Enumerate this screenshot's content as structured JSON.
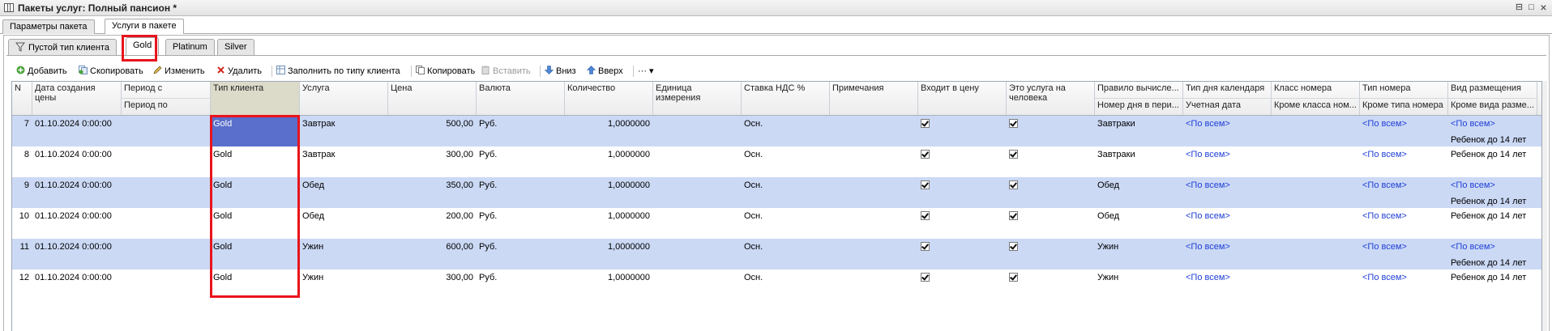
{
  "window": {
    "title": "Пакеты услуг: Полный пансион *",
    "restore_glyph": "⊟",
    "maximize_glyph": "□",
    "close_glyph": "×"
  },
  "main_tabs": [
    {
      "label": "Параметры пакета",
      "active": false
    },
    {
      "label": "Услуги в пакете",
      "active": true
    }
  ],
  "client_tabs": [
    {
      "label": "Пустой тип клиента",
      "active": false
    },
    {
      "label": "Gold",
      "active": true
    },
    {
      "label": "Platinum",
      "active": false
    },
    {
      "label": "Silver",
      "active": false
    }
  ],
  "toolbar": {
    "add": "Добавить",
    "copy_row": "Скопировать",
    "edit": "Изменить",
    "delete": "Удалить",
    "fill_by_client_type": "Заполнить по типу клиента",
    "copy": "Копировать",
    "paste": "Вставить",
    "down": "Вниз",
    "up": "Вверх",
    "more": "··· ▾"
  },
  "columns": {
    "n": "N",
    "date": "Дата создания цены",
    "period_from": "Период с",
    "period_to": "Период по",
    "client_type": "Тип клиента",
    "service": "Услуга",
    "price": "Цена",
    "currency": "Валюта",
    "quantity": "Количество",
    "unit": "Единица измерения",
    "vat": "Ставка НДС %",
    "notes": "Примечания",
    "in_price": "Входит в цену",
    "per_person": "Это услуга на человека",
    "calc_rule": "Правило вычисле...",
    "day_no": "Номер дня в пери...",
    "calendar_day": "Тип дня календаря",
    "account_date": "Учетная дата",
    "room_class": "Класс номера",
    "except_room_class": "Кроме класса ном...",
    "room_type": "Тип номера",
    "except_room_type": "Кроме типа номера",
    "accommodation": "Вид размещения",
    "except_accommodation": "Кроме вида разме..."
  },
  "rows": [
    {
      "n": "7",
      "date": "01.10.2024 0:00:00",
      "client_type": "Gold",
      "service": "Завтрак",
      "price": "500,00",
      "currency": "Руб.",
      "quantity": "1,0000000",
      "vat": "Осн.",
      "in_price": true,
      "per_person": true,
      "calc_rule": "Завтраки",
      "calendar_day": "<По всем>",
      "room_type": "<По всем>",
      "accommodation": "<По всем>",
      "accommodation2": "Ребенок до 14 лет"
    },
    {
      "n": "8",
      "date": "01.10.2024 0:00:00",
      "client_type": "Gold",
      "service": "Завтрак",
      "price": "300,00",
      "currency": "Руб.",
      "quantity": "1,0000000",
      "vat": "Осн.",
      "in_price": true,
      "per_person": true,
      "calc_rule": "Завтраки",
      "calendar_day": "<По всем>",
      "room_type": "<По всем>",
      "accommodation": "Ребенок до 14 лет",
      "accommodation2": ""
    },
    {
      "n": "9",
      "date": "01.10.2024 0:00:00",
      "client_type": "Gold",
      "service": "Обед",
      "price": "350,00",
      "currency": "Руб.",
      "quantity": "1,0000000",
      "vat": "Осн.",
      "in_price": true,
      "per_person": true,
      "calc_rule": "Обед",
      "calendar_day": "<По всем>",
      "room_type": "<По всем>",
      "accommodation": "<По всем>",
      "accommodation2": "Ребенок до 14 лет"
    },
    {
      "n": "10",
      "date": "01.10.2024 0:00:00",
      "client_type": "Gold",
      "service": "Обед",
      "price": "200,00",
      "currency": "Руб.",
      "quantity": "1,0000000",
      "vat": "Осн.",
      "in_price": true,
      "per_person": true,
      "calc_rule": "Обед",
      "calendar_day": "<По всем>",
      "room_type": "<По всем>",
      "accommodation": "Ребенок до 14 лет",
      "accommodation2": ""
    },
    {
      "n": "11",
      "date": "01.10.2024 0:00:00",
      "client_type": "Gold",
      "service": "Ужин",
      "price": "600,00",
      "currency": "Руб.",
      "quantity": "1,0000000",
      "vat": "Осн.",
      "in_price": true,
      "per_person": true,
      "calc_rule": "Ужин",
      "calendar_day": "<По всем>",
      "room_type": "<По всем>",
      "accommodation": "<По всем>",
      "accommodation2": "Ребенок до 14 лет"
    },
    {
      "n": "12",
      "date": "01.10.2024 0:00:00",
      "client_type": "Gold",
      "service": "Ужин",
      "price": "300,00",
      "currency": "Руб.",
      "quantity": "1,0000000",
      "vat": "Осн.",
      "in_price": true,
      "per_person": true,
      "calc_rule": "Ужин",
      "calendar_day": "<По всем>",
      "room_type": "<По всем>",
      "accommodation": "Ребенок до 14 лет",
      "accommodation2": ""
    }
  ],
  "colors": {
    "highlight_box": "#e8141c",
    "row_stripe": "#cbd9f5",
    "selected_cell": "#5a6fcb",
    "link": "#1f3fd6"
  }
}
